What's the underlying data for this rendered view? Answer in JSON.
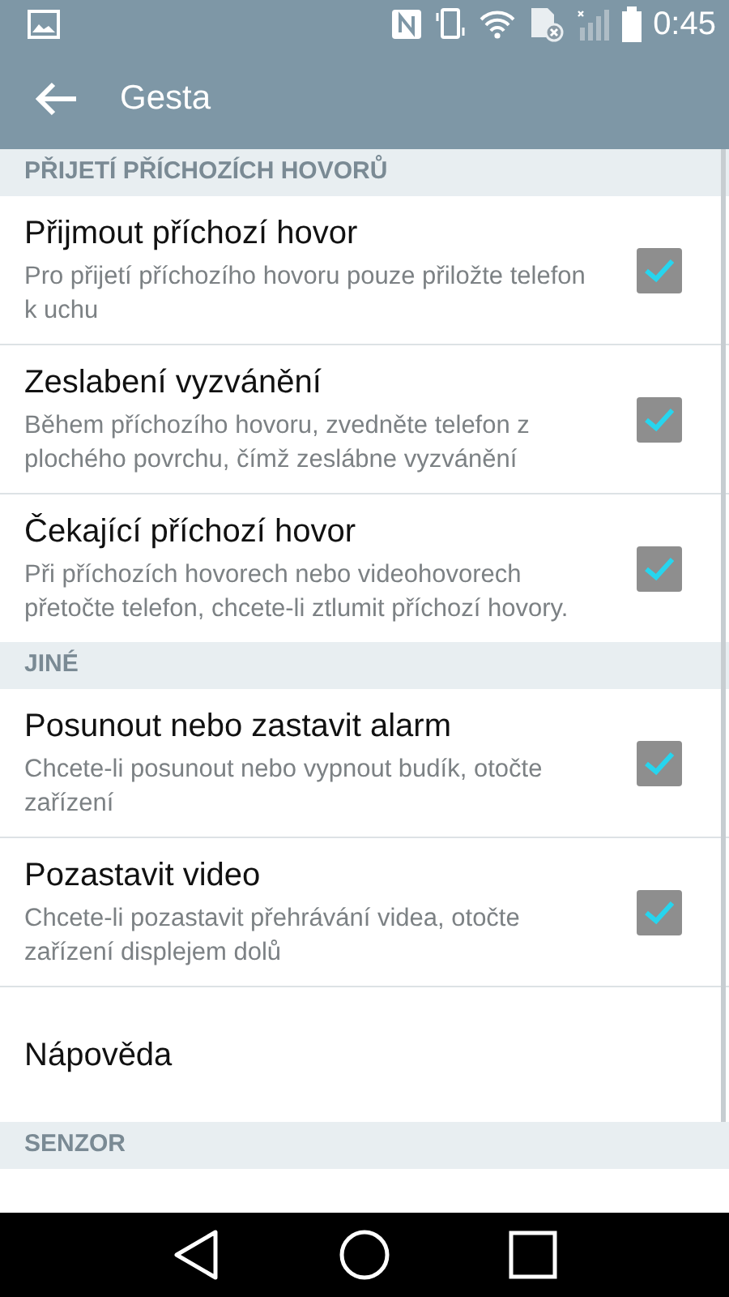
{
  "status_bar": {
    "time": "0:45"
  },
  "app_bar": {
    "title": "Gesta"
  },
  "sections": [
    {
      "header": "PŘIJETÍ PŘÍCHOZÍCH HOVORŮ",
      "items": [
        {
          "kind": "check",
          "title": "Přijmout příchozí hovor",
          "summary": "Pro přijetí příchozího hovoru pouze přiložte telefon k uchu",
          "checked": true
        },
        {
          "kind": "check",
          "title": "Zeslabení vyzvánění",
          "summary": "Během příchozího hovoru, zvedněte telefon z plochého povrchu, čímž zeslábne vyzvánění",
          "checked": true
        },
        {
          "kind": "check",
          "title": "Čekající příchozí hovor",
          "summary": "Při příchozích hovorech nebo videohovorech přetočte telefon, chcete-li ztlumit příchozí hovory.",
          "checked": true
        }
      ]
    },
    {
      "header": "JINÉ",
      "items": [
        {
          "kind": "check",
          "title": "Posunout nebo zastavit alarm",
          "summary": "Chcete-li posunout nebo vypnout budík, otočte zařízení",
          "checked": true
        },
        {
          "kind": "check",
          "title": "Pozastavit video",
          "summary": "Chcete-li pozastavit přehrávání videa, otočte zařízení displejem dolů",
          "checked": true
        },
        {
          "kind": "plain",
          "title": "Nápověda"
        }
      ]
    },
    {
      "header": "SENZOR"
    }
  ]
}
